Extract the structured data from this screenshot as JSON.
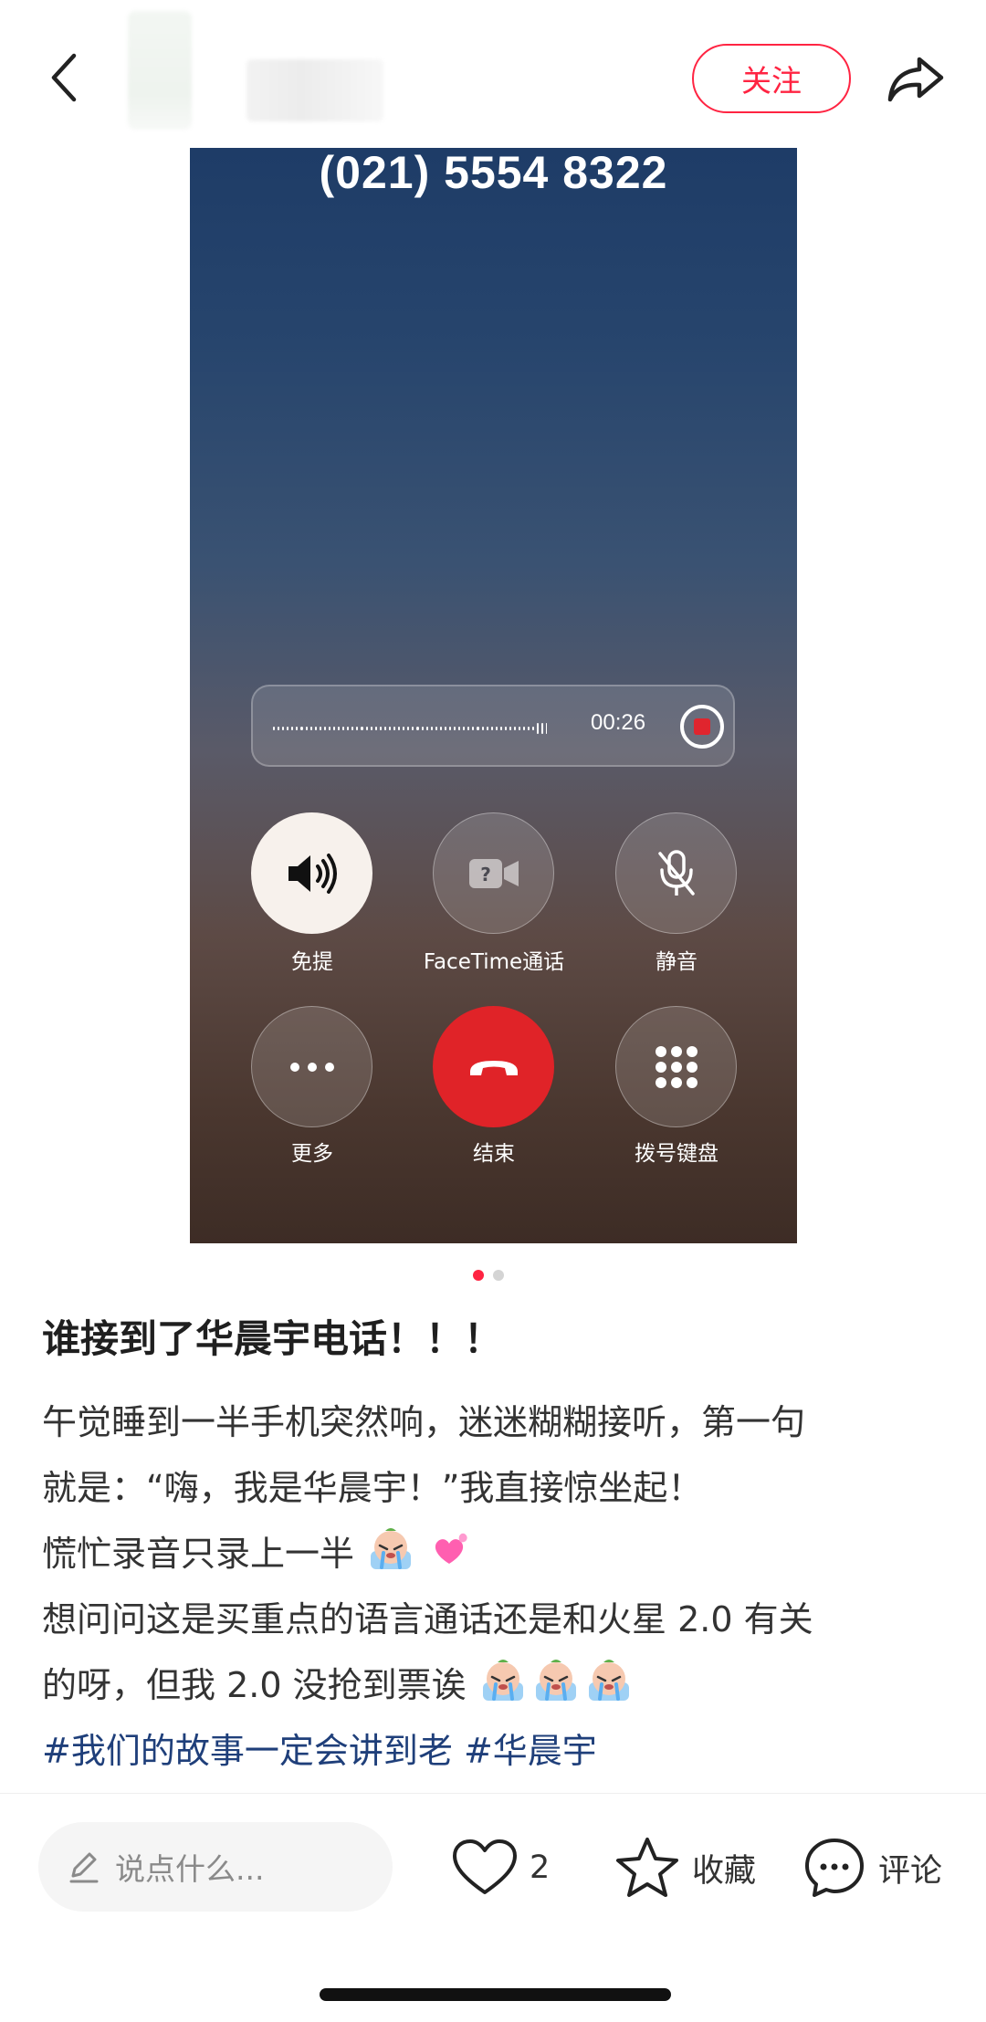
{
  "header": {
    "back_icon": "chevron-left-icon",
    "follow_label": "关注",
    "share_icon": "share-arrow-icon",
    "accent_color": "#ff2442"
  },
  "call_screen": {
    "phone_number": "(021) 5554 8322",
    "record_time": "00:26",
    "buttons": [
      {
        "label": "免提",
        "icon": "speaker-icon"
      },
      {
        "label": "FaceTime通话",
        "icon": "facetime-video-icon"
      },
      {
        "label": "静音",
        "icon": "mute-mic-icon"
      },
      {
        "label": "更多",
        "icon": "more-dots-icon"
      },
      {
        "label": "结束",
        "icon": "end-call-icon"
      },
      {
        "label": "拨号键盘",
        "icon": "keypad-icon"
      }
    ]
  },
  "carousel": {
    "count": 2,
    "active": 1
  },
  "post": {
    "title": "谁接到了华晨宇电话！！！",
    "lines": [
      "午觉睡到一半手机突然响，迷迷糊糊接听，第一句",
      "就是：“嗨，我是华晨宇！”我直接惊坐起！",
      "慌忙录音只录上一半",
      "想问问这是买重点的语言通话还是和火星 2.0 有关",
      "的呀，但我 2.0 没抢到票诶"
    ],
    "tags": [
      "#我们的故事一定会讲到老",
      "#华晨宇"
    ]
  },
  "bottom_bar": {
    "comment_placeholder": "说点什么...",
    "like_count": "2",
    "collect_label": "收藏",
    "comment_label": "评论"
  }
}
